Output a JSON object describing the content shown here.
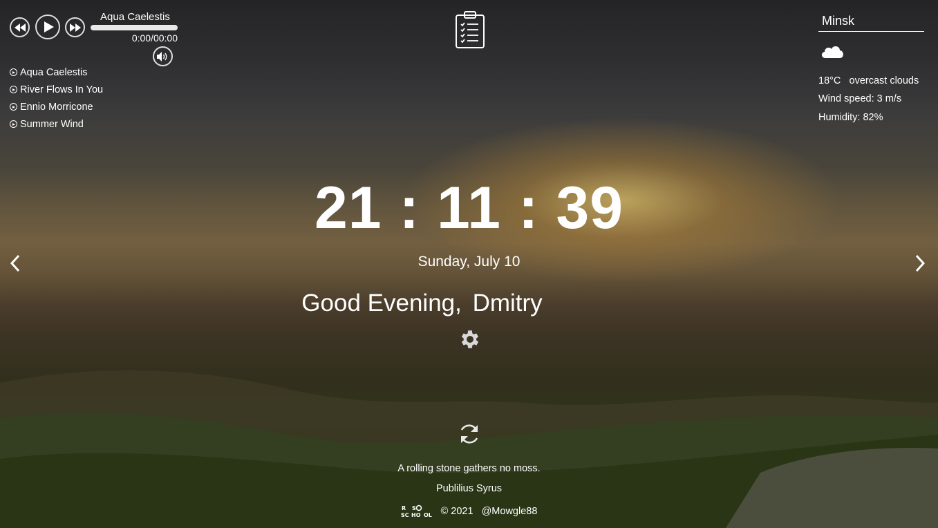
{
  "player": {
    "current_track": "Aqua Caelestis",
    "time": "0:00/00:00",
    "progress": 0,
    "playlist": [
      {
        "label": "Aqua Caelestis"
      },
      {
        "label": "River Flows In You"
      },
      {
        "label": "Ennio Morricone"
      },
      {
        "label": "Summer Wind"
      }
    ]
  },
  "weather": {
    "city": "Minsk",
    "icon": "cloud-icon",
    "temperature": "18°C",
    "description": "overcast clouds",
    "wind": "Wind speed: 3 m/s",
    "humidity": "Humidity: 82%"
  },
  "clock": {
    "time": "21:11:39",
    "date": "Sunday, July 10"
  },
  "greeting": {
    "text": "Good Evening,",
    "name": "Dmitry"
  },
  "quote": {
    "text": "A rolling stone gathers no moss.",
    "author": "Publilius Syrus"
  },
  "footer": {
    "copyright": "© 2021",
    "github": "@Mowgle88"
  },
  "colors": {
    "text": "#ffffff",
    "progress_track": "#e9e9e9"
  }
}
